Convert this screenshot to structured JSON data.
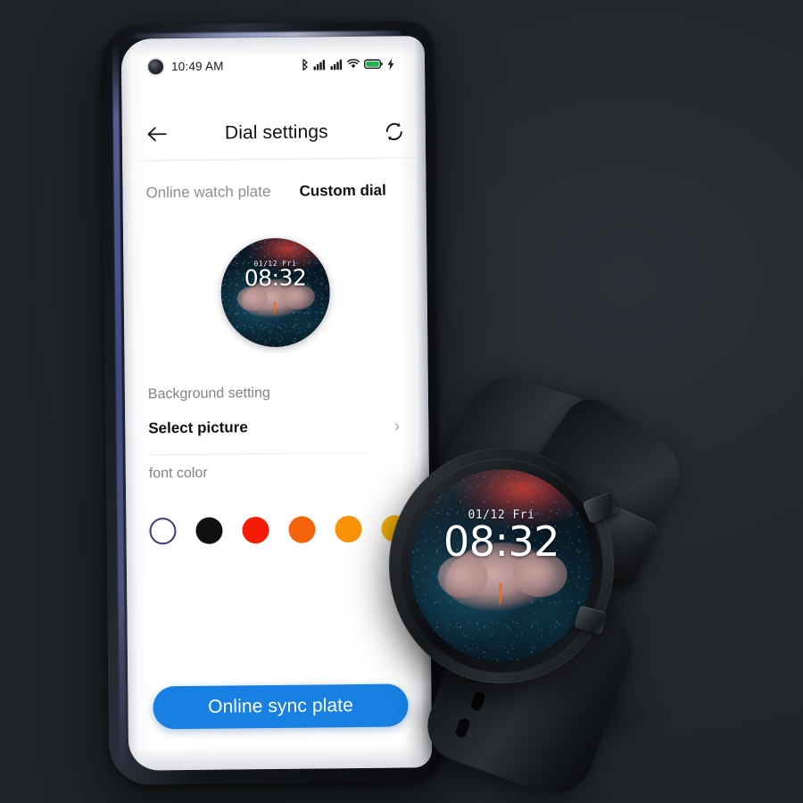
{
  "app": {
    "background_color": "#23282c"
  },
  "phone": {
    "statusbar": {
      "time": "10:49 AM",
      "icons": [
        {
          "name": "bluetooth-icon"
        },
        {
          "name": "signal-bars-sim1-icon"
        },
        {
          "name": "signal-bars-sim2-icon"
        },
        {
          "name": "wifi-icon"
        },
        {
          "name": "battery-icon",
          "color": "#22b24c"
        },
        {
          "name": "charging-bolt-icon"
        }
      ],
      "camera": "punch-hole-camera"
    },
    "appbar": {
      "back_icon": "back-arrow-icon",
      "title": "Dial settings",
      "sync_icon": "sync-refresh-icon"
    },
    "tabs": [
      {
        "label": "Online watch plate",
        "active": false
      },
      {
        "label": "Custom dial",
        "active": true
      }
    ],
    "preview": {
      "date": "01/12  Fri",
      "time": "08:32"
    },
    "sections": {
      "background_label": "Background setting",
      "select_picture": "Select picture",
      "chevron": "›",
      "font_color_label": "font color"
    },
    "font_colors": [
      {
        "name": "white",
        "hex": "#ffffff",
        "selected": true,
        "ring": "#3b3a78"
      },
      {
        "name": "black",
        "hex": "#120f10",
        "selected": false
      },
      {
        "name": "red",
        "hex": "#f71b06",
        "selected": false
      },
      {
        "name": "orange-red",
        "hex": "#f5640d",
        "selected": false
      },
      {
        "name": "orange",
        "hex": "#fb9309",
        "selected": false
      },
      {
        "name": "amber",
        "hex": "#fcb608",
        "selected": false
      },
      {
        "name": "yellow",
        "hex": "#fbe007",
        "selected": false
      }
    ],
    "cta": {
      "label": "Online sync plate",
      "color": "#1780e2"
    }
  },
  "watch": {
    "face": {
      "date": "01/12  Fri",
      "time": "08:32"
    },
    "crowns": [
      "upper-crown",
      "lower-crown"
    ],
    "strap": "black-silicone-strap",
    "buckle": "strap-buckle"
  }
}
